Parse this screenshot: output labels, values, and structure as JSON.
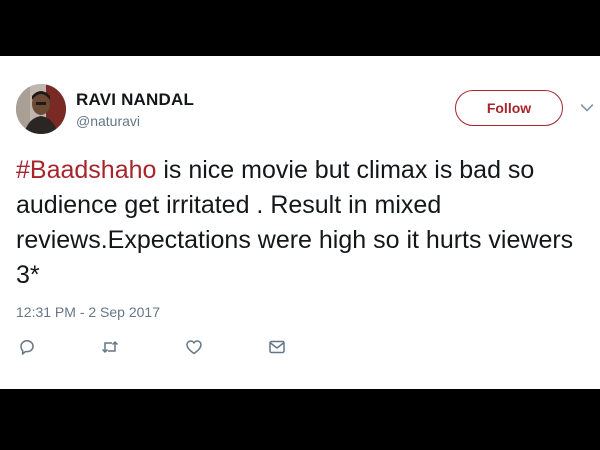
{
  "author": {
    "name": "RAVI NANDAL",
    "handle": "@naturavi"
  },
  "follow_label": "Follow",
  "tweet": {
    "hashtag": "#Baadshaho",
    "body": " is nice movie but climax is bad so audience get irritated . Result in mixed reviews.Expectations were high so it hurts viewers 3*"
  },
  "timestamp": "12:31 PM - 2 Sep 2017",
  "icons": {
    "reply": "reply-icon",
    "retweet": "retweet-icon",
    "like": "heart-icon",
    "message": "envelope-icon",
    "menu": "chevron-down-icon"
  },
  "colors": {
    "accent": "#a8242c",
    "text": "#14171a",
    "muted": "#657786",
    "background": "#ffffff",
    "letterbox": "#000000"
  }
}
